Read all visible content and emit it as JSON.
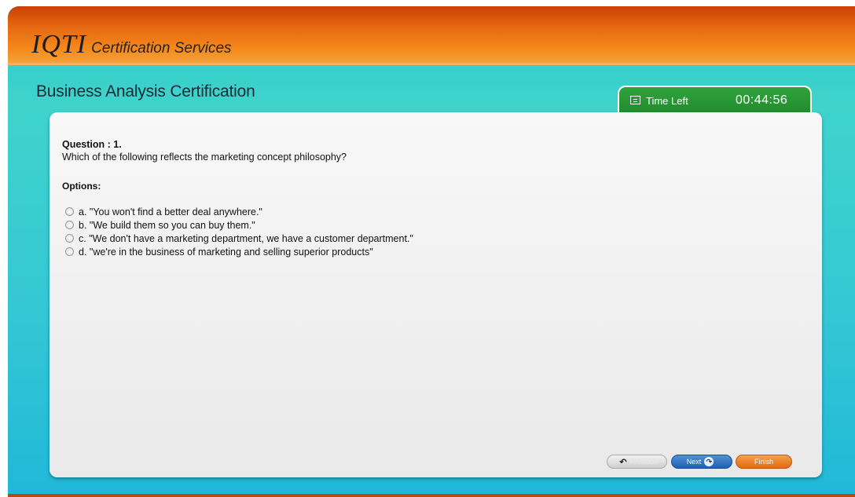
{
  "header": {
    "logo_mark": "IQTI",
    "logo_text": "Certification Services"
  },
  "page_title": "Business Analysis Certification",
  "timer": {
    "label": "Time Left",
    "value": "00:44:56"
  },
  "question": {
    "number_label": "Question : 1.",
    "text": "Which of the following reflects the marketing concept philosophy?",
    "options_label": "Options:",
    "options": [
      {
        "label": "a. \"You won't find a better deal anywhere.\""
      },
      {
        "label": "b. \"We build them so you can buy them.\""
      },
      {
        "label": "c. \"We don't have a marketing department, we have a customer department.\""
      },
      {
        "label": "d. \"we're in the business of marketing and selling superior products\""
      }
    ]
  },
  "navigation": {
    "previous_label": "Previous",
    "next_label": "Next",
    "finish_label": "Finish"
  },
  "colors": {
    "header_orange": "#e2620f",
    "background_teal": "#3fd3cc",
    "timer_green": "#1f8a2d",
    "next_blue": "#1f5fb0",
    "finish_orange": "#e06a10"
  }
}
